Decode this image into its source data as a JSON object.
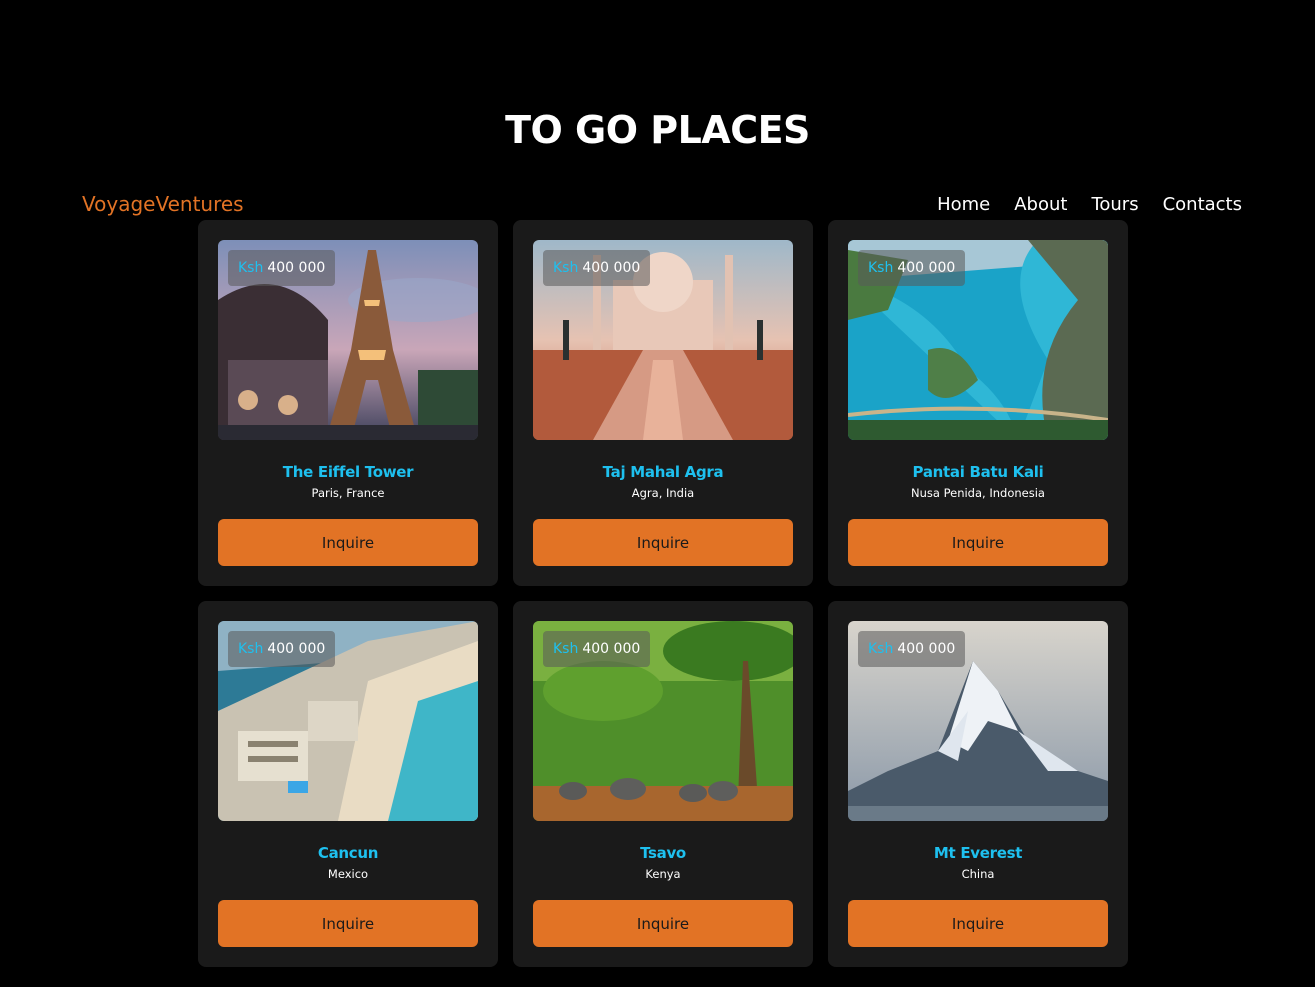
{
  "page": {
    "title": "TO GO PLACES"
  },
  "header": {
    "brand": "VoyageVentures",
    "nav": [
      "Home",
      "About",
      "Tours",
      "Contacts"
    ]
  },
  "colors": {
    "accent": "#e27325",
    "highlight": "#1ec0ef",
    "card_bg": "#1a1a1a",
    "page_bg": "#000000"
  },
  "cards": [
    {
      "currency": "Ksh",
      "price": "400 000",
      "name": "The Eiffel Tower",
      "location": "Paris, France",
      "button": "Inquire",
      "image": "eiffel-tower-photo"
    },
    {
      "currency": "Ksh",
      "price": "400 000",
      "name": "Taj Mahal Agra",
      "location": "Agra, India",
      "button": "Inquire",
      "image": "taj-mahal-photo"
    },
    {
      "currency": "Ksh",
      "price": "400 000",
      "name": "Pantai Batu Kali",
      "location": "Nusa Penida, Indonesia",
      "button": "Inquire",
      "image": "pantai-batu-kali-photo"
    },
    {
      "currency": "Ksh",
      "price": "400 000",
      "name": "Cancun",
      "location": "Mexico",
      "button": "Inquire",
      "image": "cancun-photo"
    },
    {
      "currency": "Ksh",
      "price": "400 000",
      "name": "Tsavo",
      "location": "Kenya",
      "button": "Inquire",
      "image": "tsavo-photo"
    },
    {
      "currency": "Ksh",
      "price": "400 000",
      "name": "Mt Everest",
      "location": "China",
      "button": "Inquire",
      "image": "mt-everest-photo"
    }
  ]
}
